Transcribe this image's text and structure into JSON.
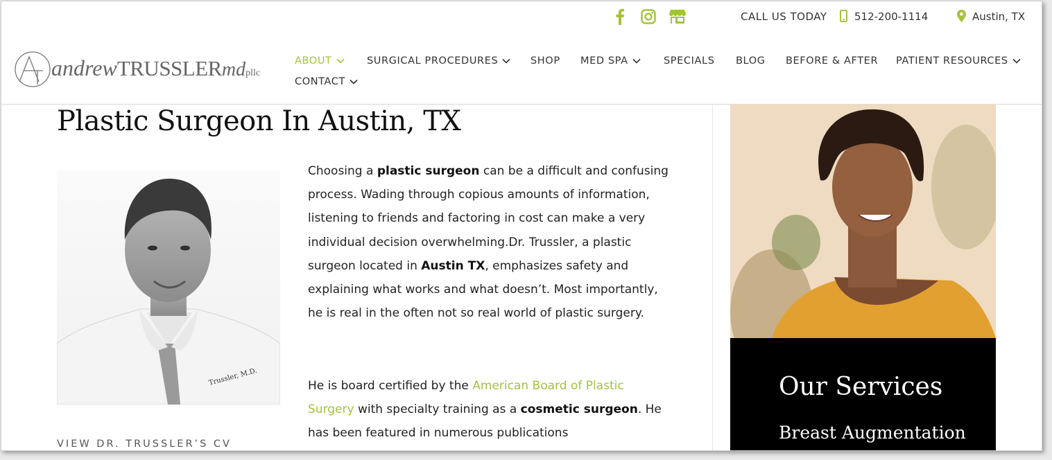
{
  "topbar": {
    "call_label": "CALL US TODAY",
    "phone": "512-200-1114",
    "location": "Austin, TX",
    "accent_color": "#a3c33a",
    "icons": [
      "facebook-icon",
      "instagram-icon",
      "store-icon",
      "mobile-phone-icon",
      "map-pin-icon"
    ]
  },
  "logo": {
    "monogram": "AT",
    "first": "andrew",
    "last": "TRUSSLER",
    "md": "md",
    "suffix": "pllc"
  },
  "nav": {
    "about": "ABOUT",
    "surgical": "SURGICAL PROCEDURES",
    "shop": "SHOP",
    "medspa": "MED SPA",
    "specials": "SPECIALS",
    "blog": "BLOG",
    "before_after": "BEFORE & AFTER",
    "patient": "PATIENT RESOURCES",
    "contact": "CONTACT"
  },
  "main": {
    "title": "Plastic Surgeon In Austin, TX",
    "p1_a": "Choosing a ",
    "p1_b": "plastic surgeon",
    "p1_c": " can be a difficult and confusing process. Wading through copious amounts of information, listening to friends and factoring in cost can make a very individual decision overwhelming.Dr. Trussler, a plastic surgeon located in ",
    "p1_d": "Austin TX",
    "p1_e": ", emphasizes safety and explaining what works and what doesn’t. Most importantly, he is real in the often not so real world of plastic surgery.",
    "p2_a": "He is board certified by the ",
    "p2_link": "American Board of Plastic Surgery",
    "p2_b": " with specialty training as a ",
    "p2_c": "cosmetic surgeon",
    "p2_d": ". He has been featured in numerous publications",
    "cv_link": "VIEW DR. TRUSSLER’S CV"
  },
  "sidebar": {
    "heading": "Our Services",
    "first_service": "Breast Augmentation"
  }
}
